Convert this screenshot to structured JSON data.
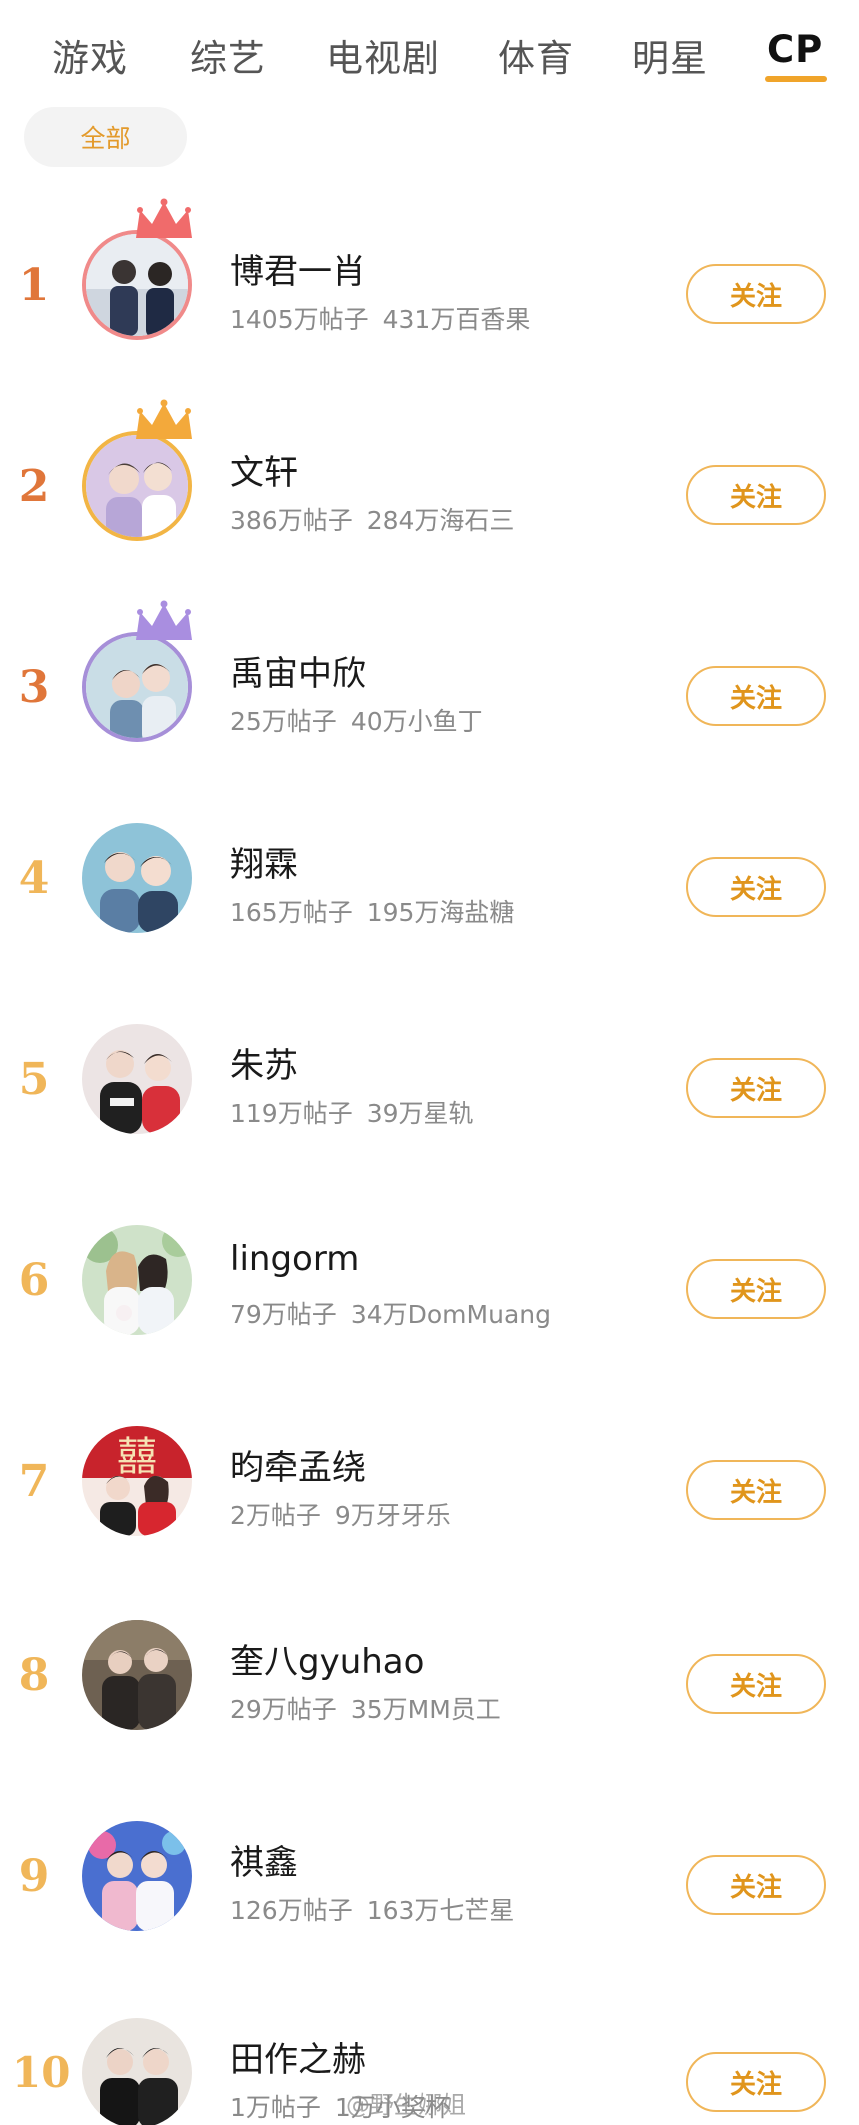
{
  "tabs": [
    {
      "label": "游戏"
    },
    {
      "label": "综艺"
    },
    {
      "label": "电视剧"
    },
    {
      "label": "体育"
    },
    {
      "label": "明星"
    },
    {
      "label": "CP"
    }
  ],
  "active_tab": "CP",
  "filter": {
    "label": "全部"
  },
  "accent_color": "#f0a42a",
  "follow_label": "关注",
  "items": [
    {
      "rank": "1",
      "name": "博君一肖",
      "posts": "1405万帖子",
      "fans": "431万百香果",
      "crown": "red-crown-icon",
      "rank_color": "#e0763a"
    },
    {
      "rank": "2",
      "name": "文轩",
      "posts": "386万帖子",
      "fans": "284万海石三",
      "crown": "gold-crown-icon",
      "rank_color": "#e0763a"
    },
    {
      "rank": "3",
      "name": "禹宙中欣",
      "posts": "25万帖子",
      "fans": "40万小鱼丁",
      "crown": "purple-crown-icon",
      "rank_color": "#e0763a"
    },
    {
      "rank": "4",
      "name": "翔霖",
      "posts": "165万帖子",
      "fans": "195万海盐糖",
      "crown": "",
      "rank_color": "#f0b659"
    },
    {
      "rank": "5",
      "name": "朱苏",
      "posts": "119万帖子",
      "fans": "39万星轨",
      "crown": "",
      "rank_color": "#f0b659"
    },
    {
      "rank": "6",
      "name": "lingorm",
      "posts": "79万帖子",
      "fans": "34万DomMuang",
      "crown": "",
      "rank_color": "#f0b659"
    },
    {
      "rank": "7",
      "name": "昀牵孟绕",
      "posts": "2万帖子",
      "fans": "9万牙牙乐",
      "crown": "",
      "rank_color": "#f0b659"
    },
    {
      "rank": "8",
      "name": "奎八gyuhao",
      "posts": "29万帖子",
      "fans": "35万MM员工",
      "crown": "",
      "rank_color": "#f0b659"
    },
    {
      "rank": "9",
      "name": "祺鑫",
      "posts": "126万帖子",
      "fans": "163万七芒星",
      "crown": "",
      "rank_color": "#f0b659"
    },
    {
      "rank": "10",
      "name": "田作之赫",
      "posts": "1万帖子",
      "fans": "1万小奖杯",
      "crown": "",
      "rank_color": "#f0b659"
    }
  ],
  "watermark": "@野生娜姐"
}
